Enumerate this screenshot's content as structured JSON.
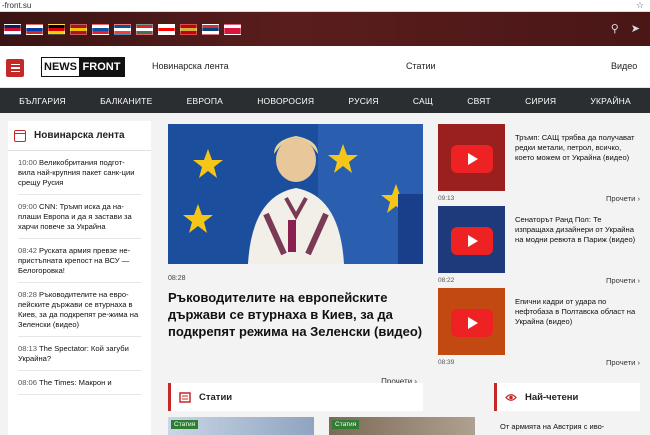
{
  "url": "-front.su",
  "flags": [
    {
      "name": "uk-flag",
      "colors": [
        "#012169",
        "#c8102e",
        "#fff"
      ]
    },
    {
      "name": "russia-flag",
      "colors": [
        "#fff",
        "#0039a6",
        "#d52b1e"
      ]
    },
    {
      "name": "germany-flag",
      "colors": [
        "#000",
        "#dd0000",
        "#ffce00"
      ]
    },
    {
      "name": "spain-flag",
      "colors": [
        "#aa151b",
        "#f1bf00",
        "#aa151b"
      ]
    },
    {
      "name": "slovakia-flag",
      "colors": [
        "#fff",
        "#0b4ea2",
        "#ee1c25"
      ]
    },
    {
      "name": "france-flag",
      "colors": [
        "#0055a4",
        "#fff",
        "#ef4135"
      ]
    },
    {
      "name": "hungary-flag",
      "colors": [
        "#ce2939",
        "#fff",
        "#477050"
      ]
    },
    {
      "name": "georgia-flag",
      "colors": [
        "#fff",
        "#ff0000",
        "#fff"
      ]
    },
    {
      "name": "montenegro-flag",
      "colors": [
        "#c40308",
        "#d3ae3b",
        "#c40308"
      ]
    },
    {
      "name": "serbia-flag",
      "colors": [
        "#c6363c",
        "#0c4076",
        "#fff"
      ]
    },
    {
      "name": "poland-flag",
      "colors": [
        "#fff",
        "#dc143c",
        "#dc143c"
      ]
    }
  ],
  "logo": {
    "news": "NEWS",
    "front": "FRONT"
  },
  "header_nav": {
    "feed": "Новинарска лента",
    "articles": "Статии",
    "video": "Видео"
  },
  "categories": [
    "БЪЛГАРИЯ",
    "БАЛКАНИТЕ",
    "ЕВРОПА",
    "НОВОРОСИЯ",
    "РУСИЯ",
    "САЩ",
    "СВЯТ",
    "СИРИЯ",
    "УКРАЙНА"
  ],
  "sidebar": {
    "title": "Новинарска лента",
    "items": [
      {
        "time": "10:00",
        "text": "Великобритания подгот-вила най-крупния пакет санк-ции срещу Русия"
      },
      {
        "time": "09:00",
        "text": "CNN: Тръмп иска да на-плаши Европа и да я застави за харчи повече за Украйна"
      },
      {
        "time": "08:42",
        "text": "Руската армия превзе не-пристъпната крепост на ВСУ — Белогоровка!"
      },
      {
        "time": "08:28",
        "text": "Ръководителите на евро-пейските държави се втурнаха в Киев, за да подкрепят ре-жима на Зеленски (видео)"
      },
      {
        "time": "08:13",
        "text": "The Spectator: Кой загуби Украйна?"
      },
      {
        "time": "08:06",
        "text": "The Times: Макрон и"
      }
    ]
  },
  "feature": {
    "time": "08:28",
    "title": "Ръководителите на европейските държави се втурнаха в Киев, за да подкрепят режима на Зеленски (видео)",
    "read_more": "Прочети"
  },
  "side_news": [
    {
      "text": "Тръмп: САЩ трябва да получават редки метали, петрол, всичко, което можем от Украйна (видео)",
      "time": "09:13",
      "read_more": "Прочети",
      "thumb_color": "#9a1f1f"
    },
    {
      "text": "Сенаторът Ранд Пол: Те изпращаха дизайнери от Украйна на модни ревюта в Париж (видео)",
      "time": "08:22",
      "read_more": "Прочети",
      "thumb_color": "#1f3a7a"
    },
    {
      "text": "Епични кадри от удара по нефтобаза в Полтавска област на Украйна (видео)",
      "time": "08:39",
      "read_more": "Прочети",
      "thumb_color": "#c24a12"
    }
  ],
  "sections": {
    "articles": "Статии",
    "most_read": "Най-четени",
    "most_read_teaser": "От армията на Австрия с иво-"
  },
  "tag_label": "Статия",
  "accent": "#c62828",
  "nav_bg": "#2b2e31"
}
